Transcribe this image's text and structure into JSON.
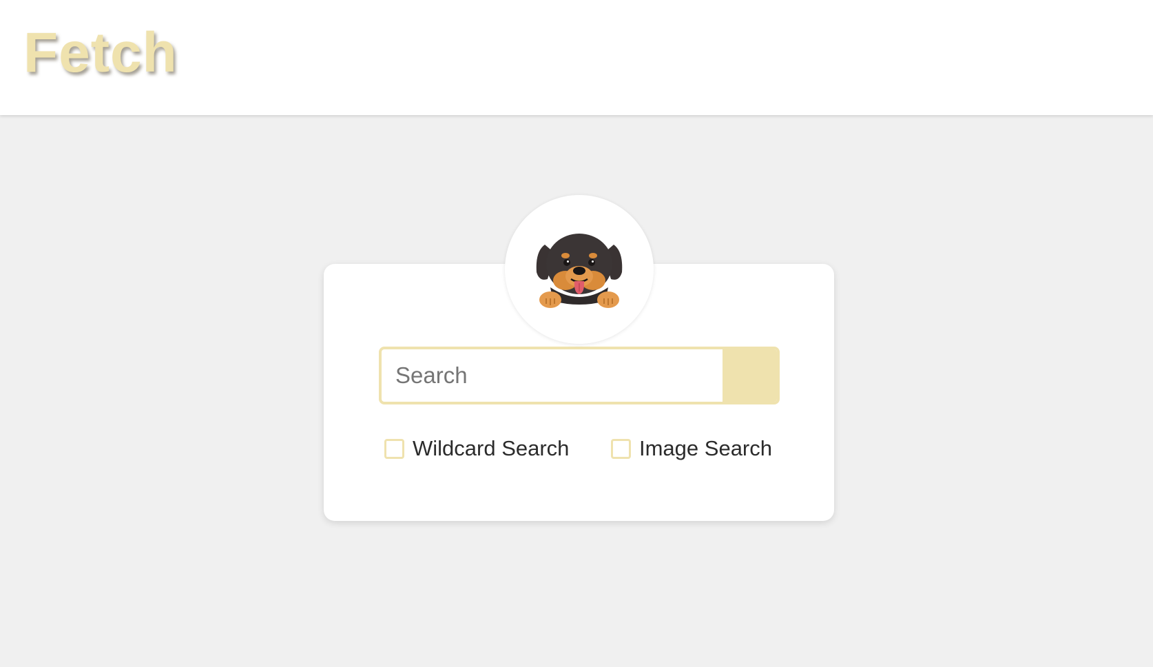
{
  "header": {
    "brand": "Fetch"
  },
  "logo": {
    "icon": "rottweiler-puppy-icon"
  },
  "search": {
    "placeholder": "Search",
    "value": ""
  },
  "options": {
    "wildcard_label": "Wildcard Search",
    "wildcard_checked": false,
    "image_label": "Image Search",
    "image_checked": false
  },
  "colors": {
    "accent": "#efe2ae",
    "background": "#f0f0f0",
    "card": "#ffffff"
  }
}
